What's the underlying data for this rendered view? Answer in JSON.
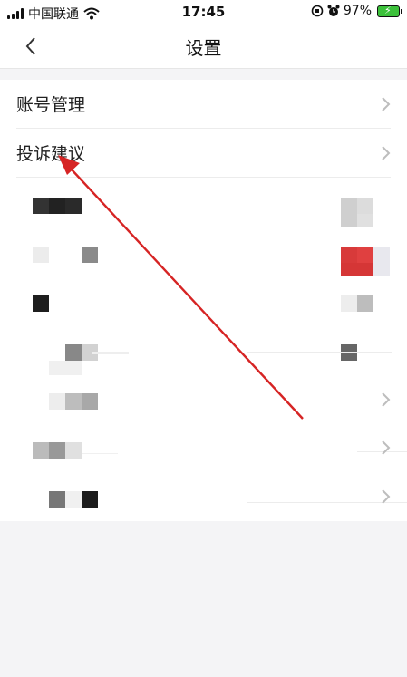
{
  "status_bar": {
    "carrier": "中国联通",
    "time": "17:45",
    "battery_percent": "97%"
  },
  "nav": {
    "title": "设置"
  },
  "settings": {
    "items": [
      {
        "label": "账号管理"
      },
      {
        "label": "投诉建议"
      }
    ]
  },
  "colors": {
    "annotation_arrow": "#d62424",
    "battery": "#3cc13b"
  }
}
